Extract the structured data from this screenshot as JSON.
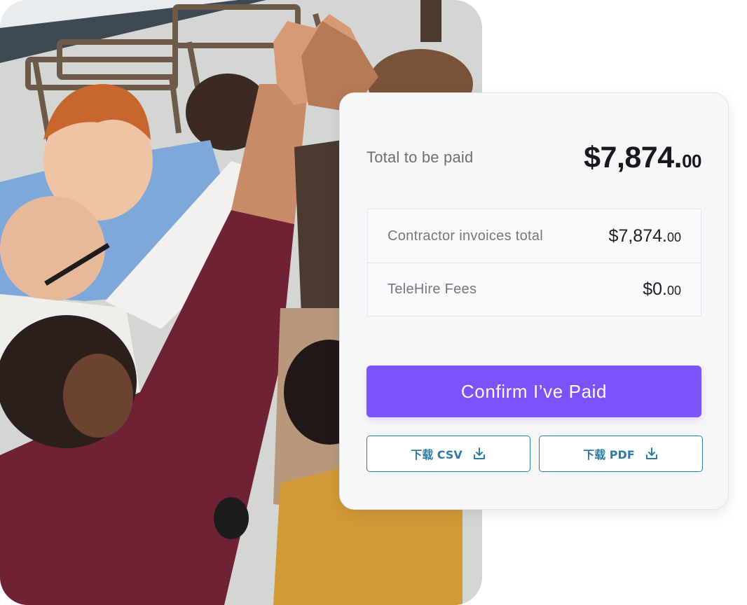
{
  "summary": {
    "total_label": "Total to be paid",
    "total_whole": "$7,874.",
    "total_cents": "00"
  },
  "breakdown": [
    {
      "label": "Contractor invoices total",
      "whole": "$7,874.",
      "cents": "00"
    },
    {
      "label": "TeleHire Fees",
      "whole": "$0.",
      "cents": "00"
    }
  ],
  "actions": {
    "confirm_label": "Confirm I’ve Paid",
    "download_csv_label": "下载 CSV",
    "download_pdf_label": "下载 PDF"
  },
  "icons": {
    "download": "download-icon"
  },
  "colors": {
    "primary": "#7b52fb",
    "outline": "#2c7aa6"
  }
}
